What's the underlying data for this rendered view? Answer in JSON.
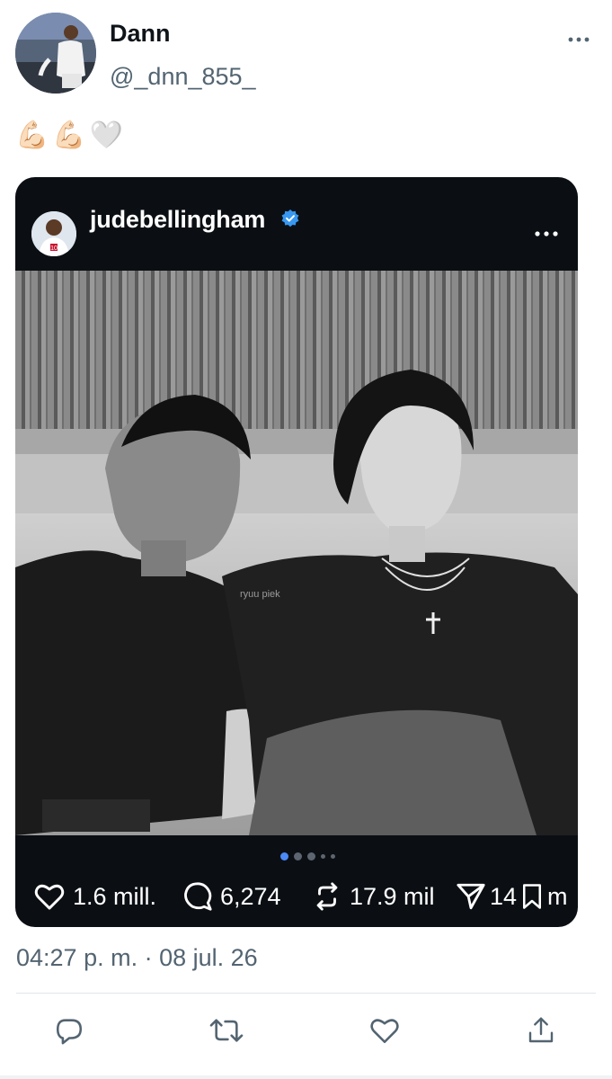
{
  "tweet": {
    "author": {
      "display_name": "Dann",
      "handle": "@_dnn_855_"
    },
    "emojis": [
      "💪🏻",
      "💪🏻",
      "🤍"
    ],
    "timestamp": "04:27 p. m. · 08 jul. 26"
  },
  "embedded_post": {
    "username": "judebellingham",
    "verified_color": "#3897f0",
    "photo_watermark": "ryuu piek",
    "carousel": {
      "count": 5,
      "active_index": 0
    },
    "stats": {
      "likes": "1.6 mill.",
      "comments": "6,274",
      "reposts": "17.9 mil",
      "shares": "14",
      "saves": "m"
    }
  },
  "icons": {
    "more": "more-horizontal-icon",
    "heart": "heart-icon",
    "comment": "comment-icon",
    "repost": "repost-icon",
    "send": "send-icon",
    "save": "bookmark-icon",
    "reply": "reply-icon",
    "retweet": "retweet-icon",
    "like": "like-icon",
    "share": "share-icon"
  },
  "colors": {
    "accent": "#1d9bf0",
    "muted": "#536471",
    "card_bg": "#0b0f14"
  }
}
